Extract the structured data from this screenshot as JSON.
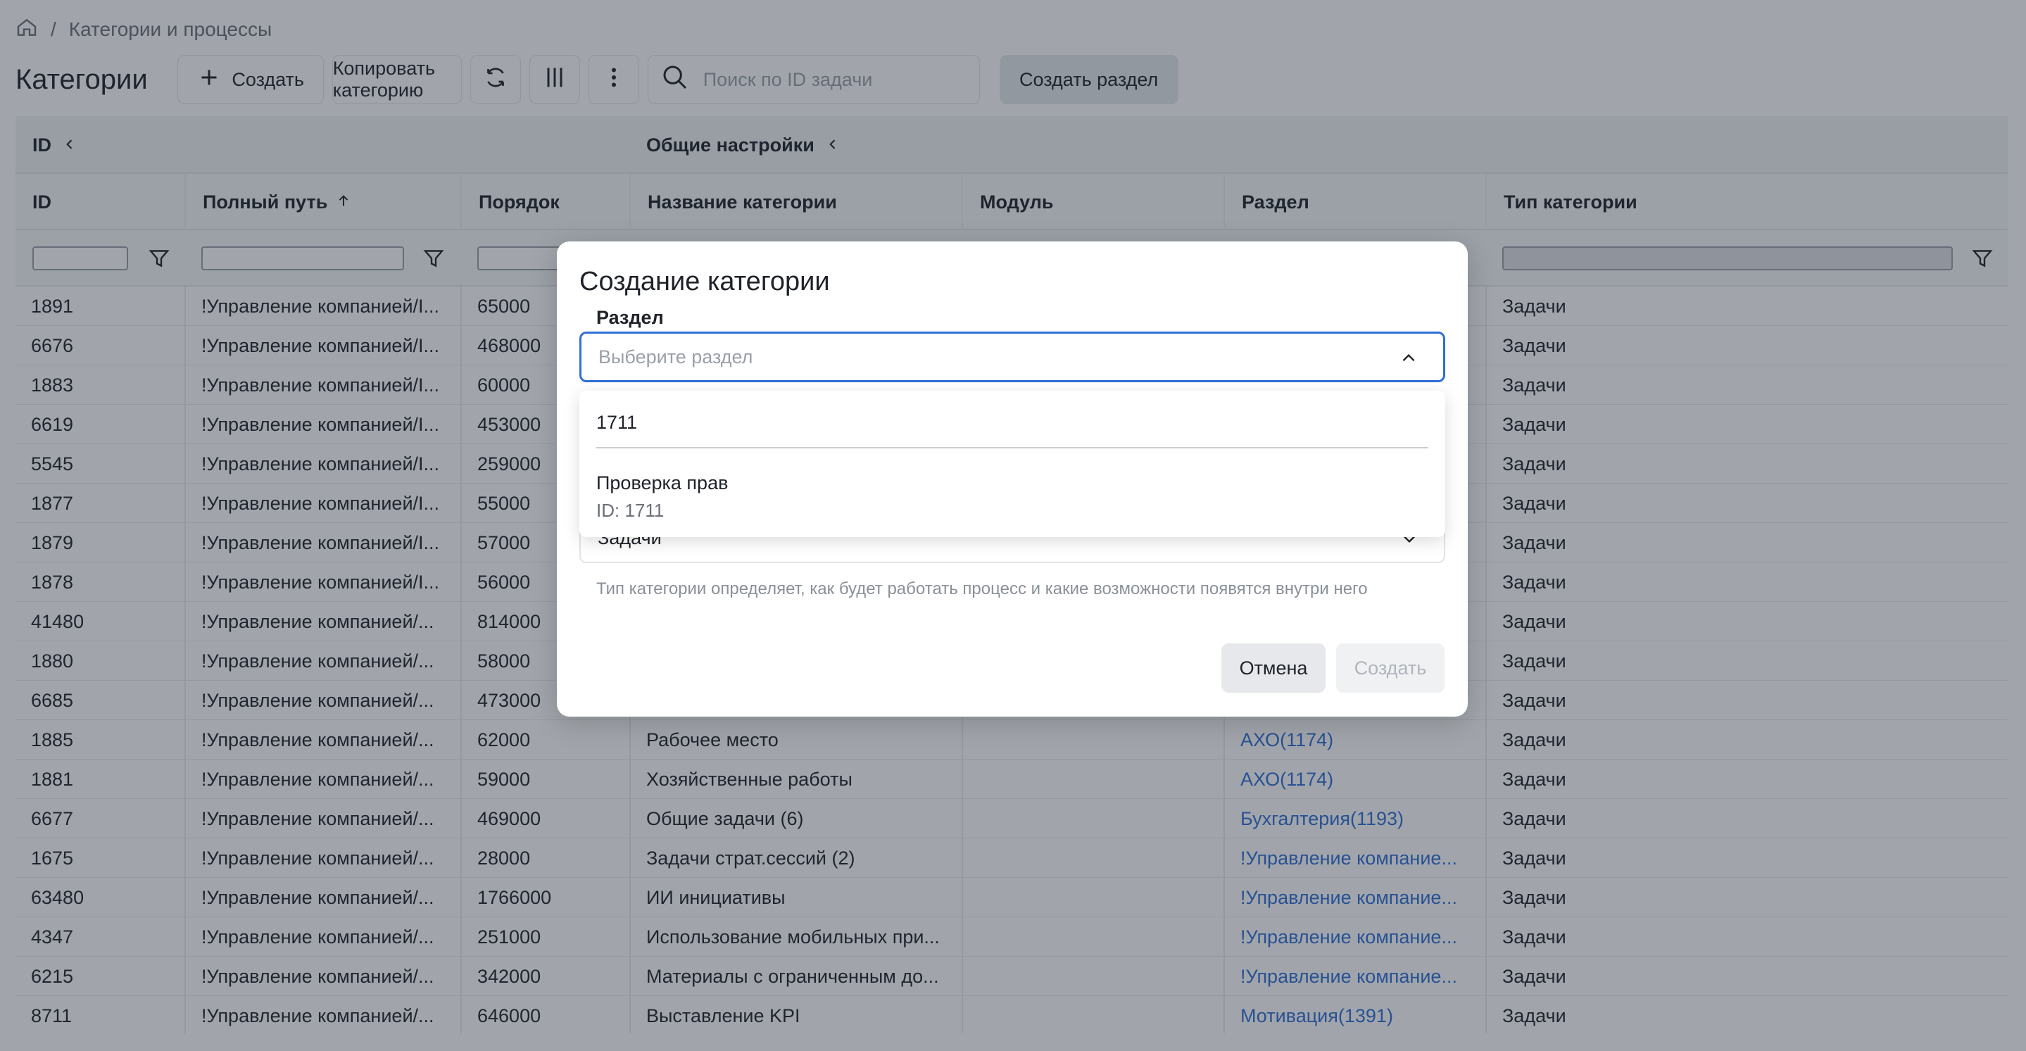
{
  "breadcrumb": {
    "separator": "/",
    "current": "Категории и процессы"
  },
  "page": {
    "title": "Категории"
  },
  "toolbar": {
    "create_label": "Создать",
    "copy_label": "Копировать категорию",
    "search_placeholder": "Поиск по ID задачи",
    "create_section_label": "Создать раздел"
  },
  "table": {
    "groups": [
      "ID",
      "Общие настройки"
    ],
    "columns": [
      "ID",
      "Полный путь",
      "Порядок",
      "Название категории",
      "Модуль",
      "Раздел",
      "Тип категории"
    ],
    "rows": [
      {
        "id": "1891",
        "path": "!Управление компанией/I...",
        "order": "65000",
        "name": "",
        "module": "",
        "section": "",
        "type": "Задачи"
      },
      {
        "id": "6676",
        "path": "!Управление компанией/I...",
        "order": "468000",
        "name": "",
        "module": "",
        "section": "",
        "type": "Задачи"
      },
      {
        "id": "1883",
        "path": "!Управление компанией/I...",
        "order": "60000",
        "name": "",
        "module": "",
        "section": "",
        "type": "Задачи"
      },
      {
        "id": "6619",
        "path": "!Управление компанией/I...",
        "order": "453000",
        "name": "",
        "module": "",
        "section": "",
        "type": "Задачи"
      },
      {
        "id": "5545",
        "path": "!Управление компанией/I...",
        "order": "259000",
        "name": "",
        "module": "",
        "section": "",
        "type": "Задачи"
      },
      {
        "id": "1877",
        "path": "!Управление компанией/I...",
        "order": "55000",
        "name": "",
        "module": "",
        "section": "",
        "type": "Задачи"
      },
      {
        "id": "1879",
        "path": "!Управление компанией/I...",
        "order": "57000",
        "name": "",
        "module": "",
        "section": "",
        "type": "Задачи"
      },
      {
        "id": "1878",
        "path": "!Управление компанией/I...",
        "order": "56000",
        "name": "",
        "module": "",
        "section": "",
        "type": "Задачи"
      },
      {
        "id": "41480",
        "path": "!Управление компанией/...",
        "order": "814000",
        "name": "",
        "module": "",
        "section": "",
        "type": "Задачи"
      },
      {
        "id": "1880",
        "path": "!Управление компанией/...",
        "order": "58000",
        "name": "",
        "module": "",
        "section": "",
        "type": "Задачи"
      },
      {
        "id": "6685",
        "path": "!Управление компанией/...",
        "order": "473000",
        "name": "",
        "module": "",
        "section": "",
        "type": "Задачи"
      },
      {
        "id": "1885",
        "path": "!Управление компанией/...",
        "order": "62000",
        "name": "Рабочее место",
        "module": "",
        "section": "АХО(1174)",
        "type": "Задачи"
      },
      {
        "id": "1881",
        "path": "!Управление компанией/...",
        "order": "59000",
        "name": "Хозяйственные работы",
        "module": "",
        "section": "АХО(1174)",
        "type": "Задачи"
      },
      {
        "id": "6677",
        "path": "!Управление компанией/...",
        "order": "469000",
        "name": "Общие задачи (6)",
        "module": "",
        "section": "Бухгалтерия(1193)",
        "type": "Задачи"
      },
      {
        "id": "1675",
        "path": "!Управление компанией/...",
        "order": "28000",
        "name": "Задачи страт.сессий (2)",
        "module": "",
        "section": "!Управление компание...",
        "type": "Задачи"
      },
      {
        "id": "63480",
        "path": "!Управление компанией/...",
        "order": "1766000",
        "name": "ИИ инициативы",
        "module": "",
        "section": "!Управление компание...",
        "type": "Задачи"
      },
      {
        "id": "4347",
        "path": "!Управление компанией/...",
        "order": "251000",
        "name": "Использование мобильных при...",
        "module": "",
        "section": "!Управление компание...",
        "type": "Задачи"
      },
      {
        "id": "6215",
        "path": "!Управление компанией/...",
        "order": "342000",
        "name": "Материалы с ограниченным до...",
        "module": "",
        "section": "!Управление компание...",
        "type": "Задачи"
      },
      {
        "id": "8711",
        "path": "!Управление компанией/...",
        "order": "646000",
        "name": "Выставление KPI",
        "module": "",
        "section": "Мотивация(1391)",
        "type": "Задачи"
      }
    ]
  },
  "modal": {
    "title": "Создание категории",
    "section_label": "Раздел",
    "section_placeholder": "Выберите раздел",
    "type_value": "Задачи",
    "type_hint": "Тип категории определяет, как будет работать процесс и какие возможности появятся внутри него",
    "cancel_label": "Отмена",
    "create_label": "Создать"
  },
  "dropdown": {
    "search_value": "1711",
    "options": [
      {
        "title": "Проверка прав",
        "subtitle": "ID: 1711"
      }
    ]
  },
  "colors": {
    "accent": "#2f6fd6",
    "link": "#2f6fd6",
    "overlay": "rgba(30,40,55,0.42)"
  }
}
